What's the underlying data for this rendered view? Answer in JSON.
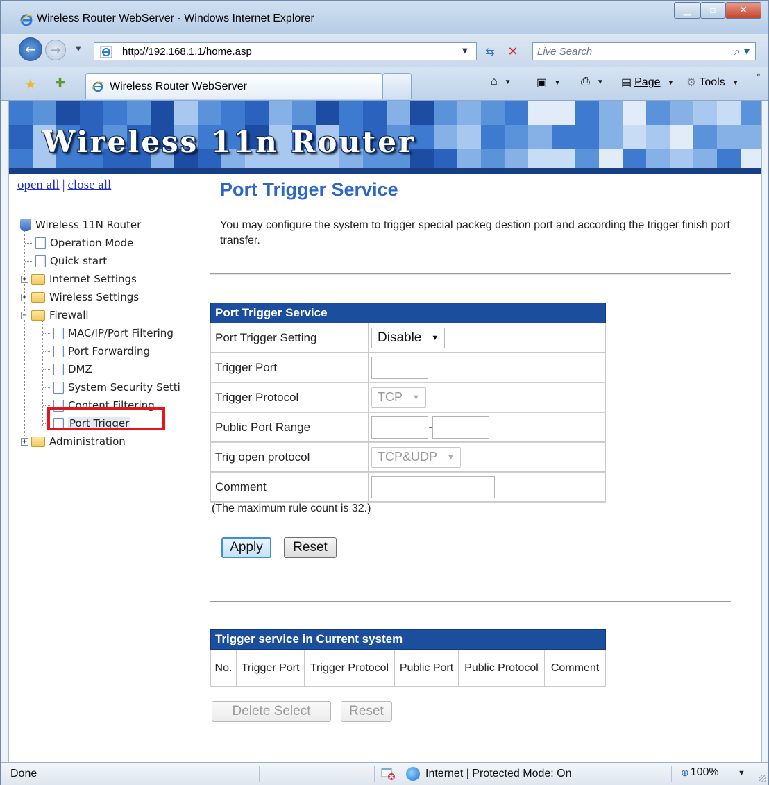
{
  "window": {
    "title": "Wireless Router WebServer - Windows Internet Explorer"
  },
  "address_bar": {
    "url": "http://192.168.1.1/home.asp",
    "search_placeholder": "Live Search"
  },
  "tab": {
    "title": "Wireless Router WebServer"
  },
  "command_bar": {
    "page_label": "Page",
    "tools_label": "Tools"
  },
  "banner": {
    "title": "Wireless 11n Router"
  },
  "tree": {
    "open_all": "open all",
    "separator": "|",
    "close_all": "close all",
    "root": "Wireless 11N Router",
    "items": [
      {
        "label": "Operation Mode"
      },
      {
        "label": "Quick start"
      },
      {
        "label": "Internet Settings"
      },
      {
        "label": "Wireless Settings"
      },
      {
        "label": "Firewall"
      },
      {
        "label": "MAC/IP/Port Filtering"
      },
      {
        "label": "Port Forwarding"
      },
      {
        "label": "DMZ"
      },
      {
        "label": "System Security Setti"
      },
      {
        "label": "Content Filtering"
      },
      {
        "label": "Port Trigger"
      },
      {
        "label": "Administration"
      }
    ],
    "highlight_color": "#e3161e"
  },
  "main": {
    "title": "Port Trigger Service",
    "description": "You may configure the system to trigger special packeg destion port and according the trigger finish port transfer.",
    "form": {
      "header": "Port Trigger Service",
      "rows": [
        {
          "label": "Port Trigger Setting",
          "value": "Disable"
        },
        {
          "label": "Trigger Port",
          "value": ""
        },
        {
          "label": "Trigger Protocol",
          "value": "TCP"
        },
        {
          "label": "Public Port Range",
          "value": ""
        },
        {
          "label": "Trig open protocol",
          "value": "TCP&UDP"
        },
        {
          "label": "Comment",
          "value": ""
        }
      ]
    },
    "max_note": "(The maximum rule count is 32.)",
    "apply_label": "Apply",
    "reset_label": "Reset",
    "list": {
      "header": "Trigger service in Current system",
      "columns": [
        "No.",
        "Trigger Port",
        "Trigger Protocol",
        "Public Port",
        "Public Protocol",
        "Comment"
      ]
    },
    "delete_label": "Delete Select",
    "reset2_label": "Reset",
    "accent_color": "#2c67c8",
    "table_header_color": "#1b4e9d"
  },
  "status_bar": {
    "status": "Done",
    "zone": "Internet | Protected Mode: On",
    "zoom": "100%"
  }
}
